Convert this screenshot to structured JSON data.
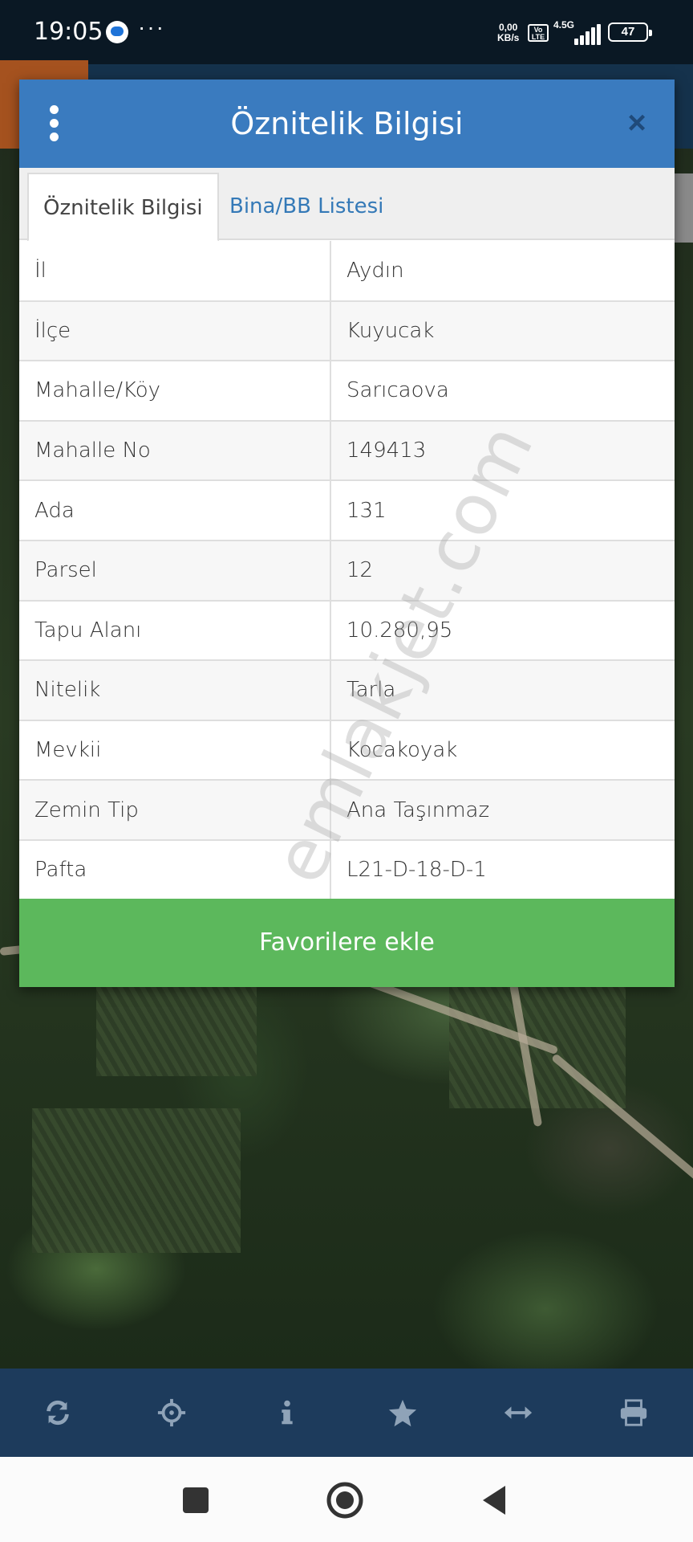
{
  "status_bar": {
    "time": "19:05",
    "more": "···",
    "net_speed_value": "0,00",
    "net_speed_unit": "KB/s",
    "volte": "Vo LTE",
    "network_type": "4.5G",
    "battery": "47"
  },
  "dialog": {
    "title": "Öznitelik Bilgisi",
    "close_label": "×",
    "tabs": [
      {
        "label": "Öznitelik Bilgisi",
        "active": true
      },
      {
        "label": "Bina/BB Listesi",
        "active": false
      }
    ],
    "rows": [
      {
        "key": "İl",
        "value": "Aydın"
      },
      {
        "key": "İlçe",
        "value": "Kuyucak"
      },
      {
        "key": "Mahalle/Köy",
        "value": "Sarıcaova"
      },
      {
        "key": "Mahalle No",
        "value": "149413"
      },
      {
        "key": "Ada",
        "value": "131"
      },
      {
        "key": "Parsel",
        "value": "12"
      },
      {
        "key": "Tapu Alanı",
        "value": "10.280,95"
      },
      {
        "key": "Nitelik",
        "value": "Tarla"
      },
      {
        "key": "Mevkii",
        "value": "Kocakoyak"
      },
      {
        "key": "Zemin Tip",
        "value": "Ana Taşınmaz"
      },
      {
        "key": "Pafta",
        "value": "L21-D-18-D-1"
      }
    ],
    "favorite_button": "Favorilere ekle"
  },
  "watermark": "emlakjet.com",
  "toolbar": {
    "icons": [
      "refresh-icon",
      "crosshair-icon",
      "info-icon",
      "star-icon",
      "measure-icon",
      "print-icon"
    ]
  },
  "colors": {
    "header_blue": "#3a7bbf",
    "tab_link_blue": "#3479b7",
    "favorite_green": "#5cb85c",
    "toolbar_navy": "#1d3b5c",
    "toolbar_icon": "#8fa3b8"
  }
}
